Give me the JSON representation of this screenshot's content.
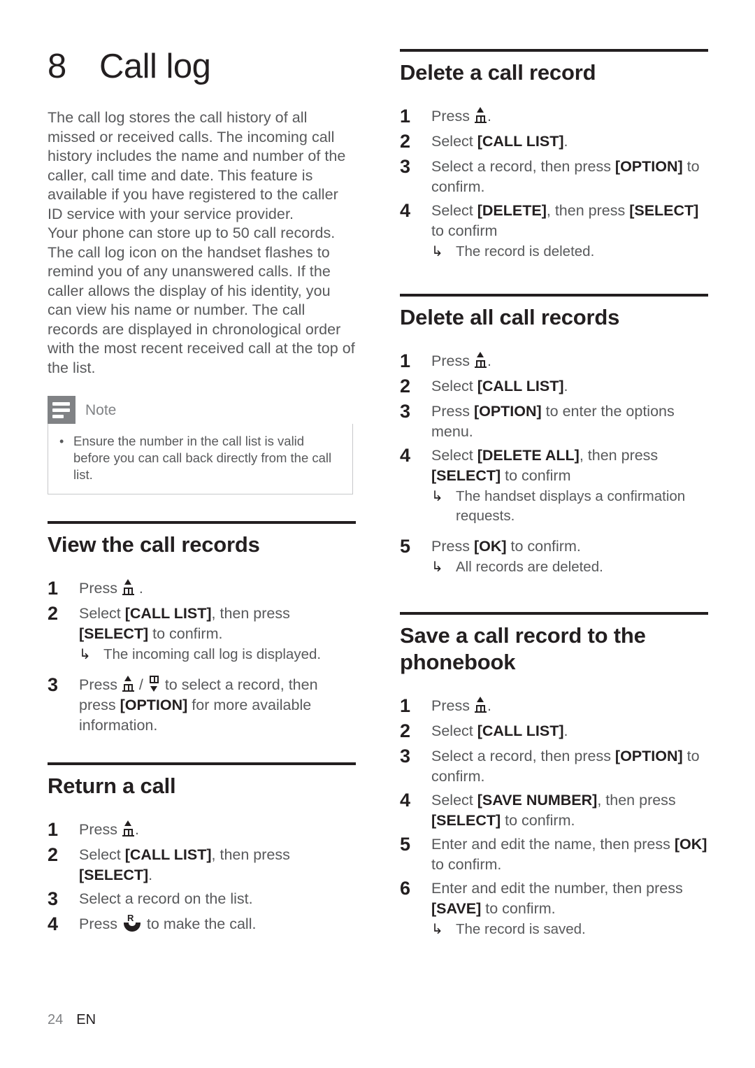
{
  "chapter": {
    "number": "8",
    "title": "Call log"
  },
  "intro": {
    "paragraph_1": "The call log stores the call history of all missed or received calls. The incoming call history includes the name and number of the caller, call time and date. This feature is available if you have registered to the caller ID service with your service provider.",
    "paragraph_2": "Your phone can store up to 50 call records. The call log icon on the handset flashes to remind you of any unanswered calls. If the caller allows the display of his identity, you can view his name or number. The call records are displayed in chronological order with the most recent received call at the top of the list."
  },
  "note": {
    "label": "Note",
    "bullet": "•",
    "text": "Ensure the number in the call list is valid before you can call back directly from the call list."
  },
  "sections": {
    "view_records": {
      "title": "View the call records",
      "steps": {
        "s1": {
          "num": "1",
          "pre": "Press ",
          "post": " ."
        },
        "s2": {
          "num": "2",
          "t1": "Select ",
          "k1": "[CALL LIST]",
          "t2": ", then press ",
          "k2": "[SELECT]",
          "t3": " to confirm.",
          "result": "The incoming call log is displayed."
        },
        "s3": {
          "num": "3",
          "t1": "Press ",
          "t2": " / ",
          "t3": " to select a record, then press ",
          "k1": "[OPTION]",
          "t4": " for more available information."
        }
      }
    },
    "return_call": {
      "title": "Return a call",
      "steps": {
        "s1": {
          "num": "1",
          "pre": "Press ",
          "post": "."
        },
        "s2": {
          "num": "2",
          "t1": "Select ",
          "k1": "[CALL LIST]",
          "t2": ", then press ",
          "k2": "[SELECT]",
          "t3": "."
        },
        "s3": {
          "num": "3",
          "t1": "Select a record on the list."
        },
        "s4": {
          "num": "4",
          "t1": "Press ",
          "t2": " to make the call."
        }
      }
    },
    "delete_record": {
      "title": "Delete a call record",
      "steps": {
        "s1": {
          "num": "1",
          "pre": "Press ",
          "post": "."
        },
        "s2": {
          "num": "2",
          "t1": "Select ",
          "k1": "[CALL LIST]",
          "t2": "."
        },
        "s3": {
          "num": "3",
          "t1": "Select a record, then press ",
          "k1": "[OPTION]",
          "t2": " to confirm."
        },
        "s4": {
          "num": "4",
          "t1": "Select ",
          "k1": "[DELETE]",
          "t2": ", then press ",
          "k2": "[SELECT]",
          "t3": " to confirm",
          "result": "The record is deleted."
        }
      }
    },
    "delete_all": {
      "title": "Delete all call records",
      "steps": {
        "s1": {
          "num": "1",
          "pre": "Press ",
          "post": "."
        },
        "s2": {
          "num": "2",
          "t1": "Select ",
          "k1": "[CALL LIST]",
          "t2": "."
        },
        "s3": {
          "num": "3",
          "t1": "Press ",
          "k1": "[OPTION]",
          "t2": " to enter the options menu."
        },
        "s4": {
          "num": "4",
          "t1": "Select ",
          "k1": "[DELETE ALL]",
          "t2": ", then press ",
          "k2": "[SELECT]",
          "t3": " to confirm",
          "result": "The handset displays a confirmation requests."
        },
        "s5": {
          "num": "5",
          "t1": "Press ",
          "k1": "[OK]",
          "t2": " to confirm.",
          "result": "All records are deleted."
        }
      }
    },
    "save_record": {
      "title": "Save a call record to the phonebook",
      "steps": {
        "s1": {
          "num": "1",
          "pre": "Press ",
          "post": "."
        },
        "s2": {
          "num": "2",
          "t1": "Select ",
          "k1": "[CALL LIST]",
          "t2": "."
        },
        "s3": {
          "num": "3",
          "t1": "Select a record, then press ",
          "k1": "[OPTION]",
          "t2": " to confirm."
        },
        "s4": {
          "num": "4",
          "t1": "Select ",
          "k1": "[SAVE NUMBER]",
          "t2": ", then press ",
          "k2": "[SELECT]",
          "t3": " to confirm."
        },
        "s5": {
          "num": "5",
          "t1": "Enter and edit the name, then press ",
          "k1": "[OK]",
          "t2": " to confirm."
        },
        "s6": {
          "num": "6",
          "t1": "Enter and edit the number, then press ",
          "k1": "[SAVE]",
          "t2": " to confirm.",
          "result": "The record is saved."
        }
      }
    }
  },
  "result_arrow": "↳",
  "footer": {
    "page_number": "24",
    "language": "EN"
  },
  "icons": {
    "up_key": "phonebook-up-key-icon",
    "down_key": "phonebook-down-key-icon",
    "call_key": "call-handset-key-icon"
  }
}
